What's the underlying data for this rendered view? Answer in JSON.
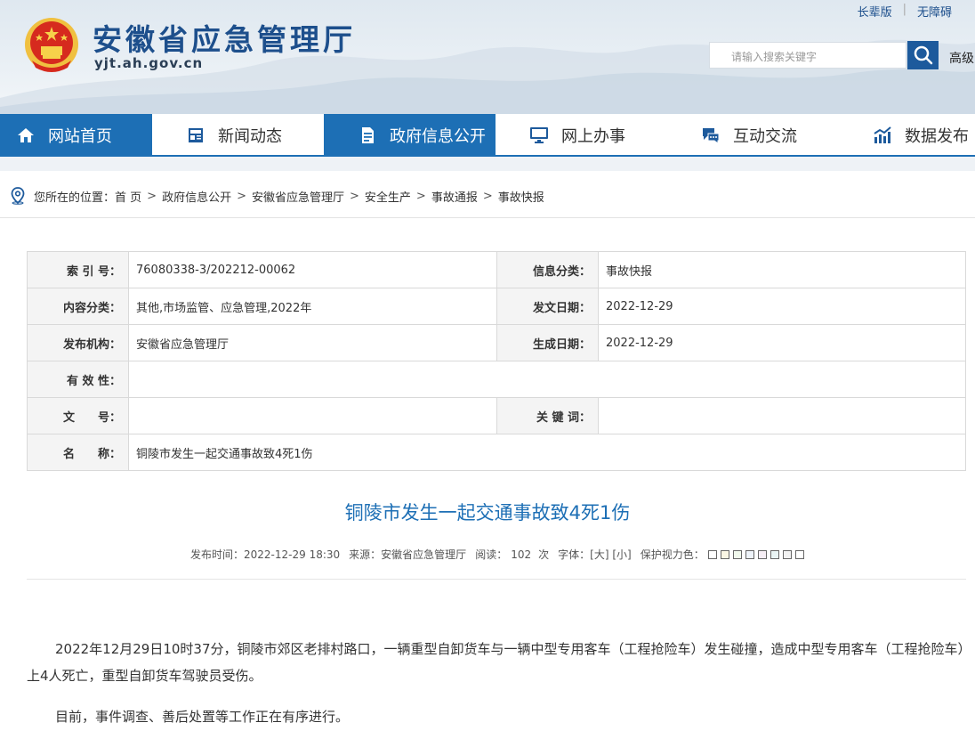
{
  "site": {
    "title": "安徽省应急管理厅",
    "domain": "yjt.ah.gov.cn",
    "top_links": [
      "长辈版",
      "无障碍"
    ],
    "search_placeholder": "请输入搜索关键字",
    "advanced_search": "高级",
    "emblem_icon": "national-emblem-icon"
  },
  "nav": {
    "items": [
      {
        "label": "网站首页",
        "icon": "home-icon",
        "active": true
      },
      {
        "label": "新闻动态",
        "icon": "news-icon",
        "active": false
      },
      {
        "label": "政府信息公开",
        "icon": "document-icon",
        "active": true
      },
      {
        "label": "网上办事",
        "icon": "monitor-icon",
        "active": false
      },
      {
        "label": "互动交流",
        "icon": "chat-icon",
        "active": false
      },
      {
        "label": "数据发布",
        "icon": "chart-icon",
        "active": false
      }
    ],
    "accent": "#1d6fb5"
  },
  "breadcrumb": {
    "prefix": "您所在的位置：",
    "items": [
      "首 页",
      "政府信息公开",
      "安徽省应急管理厅",
      "安全生产",
      "事故通报",
      "事故快报"
    ],
    "separator": ">"
  },
  "info": {
    "index_label": "索 引 号：",
    "index_value": "76080338-3/202212-00062",
    "category_label": "信息分类：",
    "category_value": "事故快报",
    "content_label": "内容分类：",
    "content_value": "其他,市场监管、应急管理,2022年",
    "issue_date_label": "发文日期：",
    "issue_date_value": "2022-12-29",
    "publisher_label": "发布机构：",
    "publisher_value": "安徽省应急管理厅",
    "gen_date_label": "生成日期：",
    "gen_date_value": "2022-12-29",
    "validity_label": "有 效 性：",
    "validity_value": "",
    "doc_no_label": "文　　号：",
    "doc_no_value": "",
    "keywords_label": "关 键 词：",
    "keywords_value": "",
    "name_label": "名　　称：",
    "name_value": "铜陵市发生一起交通事故致4死1伤"
  },
  "article": {
    "title": "铜陵市发生一起交通事故致4死1伤",
    "meta": {
      "time_label": "发布时间：",
      "time": "2022-12-29 18:30",
      "source_label": "来源：",
      "source": "安徽省应急管理厅",
      "views_label": "阅读：",
      "views": "102",
      "views_unit": "次",
      "font_label": "字体：",
      "font_big": "[大]",
      "font_small": "[小]",
      "eye_label": "保护视力色："
    },
    "swatches": [
      "#ffffff",
      "#faf6e4",
      "#f1f9ed",
      "#eef3f9",
      "#f6eef5",
      "#e9f4f4",
      "#f2f2f2",
      "#ffffff"
    ],
    "paragraphs": [
      "2022年12月29日10时37分，铜陵市郊区老排村路口，一辆重型自卸货车与一辆中型专用客车（工程抢险车）发生碰撞，造成中型专用客车（工程抢险车）上4人死亡，重型自卸货车驾驶员受伤。",
      "目前，事件调查、善后处置等工作正在有序进行。"
    ]
  }
}
